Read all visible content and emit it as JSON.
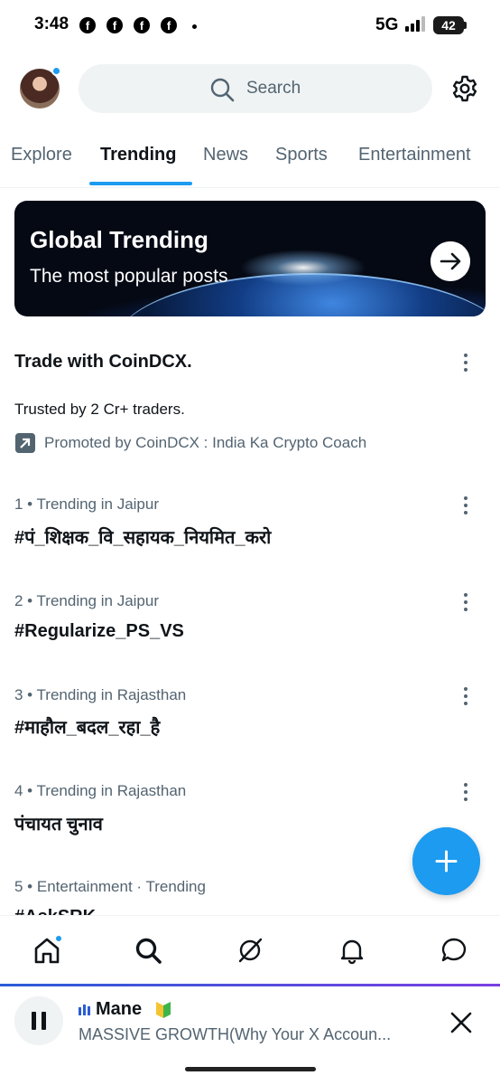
{
  "status_bar": {
    "time": "3:48",
    "notif_icons": [
      "f",
      "f",
      "f",
      "f"
    ],
    "network": "5G",
    "battery": "42"
  },
  "header": {
    "search_placeholder": "Search"
  },
  "tabs": [
    {
      "label": "Explore",
      "active": false
    },
    {
      "label": "Trending",
      "active": true
    },
    {
      "label": "News",
      "active": false
    },
    {
      "label": "Sports",
      "active": false
    },
    {
      "label": "Entertainment",
      "active": false
    }
  ],
  "banner": {
    "title": "Global Trending",
    "subtitle": "The most popular posts"
  },
  "promoted": {
    "title": "Trade with CoinDCX.",
    "body": "Trusted by 2 Cr+ traders.",
    "by": "Promoted by CoinDCX : India Ka Crypto Coach"
  },
  "trends": [
    {
      "meta": "1 • Trending in Jaipur",
      "name": "#पं_शिक्षक_वि_सहायक_नियमित_करो"
    },
    {
      "meta": "2 • Trending in Jaipur",
      "name": "#Regularize_PS_VS"
    },
    {
      "meta": "3 • Trending in Rajasthan",
      "name": "#माहौल_बदल_रहा_है"
    },
    {
      "meta": "4 • Trending in Rajasthan",
      "name": "पंचायत चुनाव"
    },
    {
      "meta": "5 • Entertainment · Trending",
      "name": "#AskSRK"
    }
  ],
  "media": {
    "channel": "Mane",
    "title": "MASSIVE GROWTH(Why Your X Accoun..."
  },
  "colors": {
    "accent": "#1d9bf0",
    "text_primary": "#0f1419",
    "text_secondary": "#536471"
  }
}
